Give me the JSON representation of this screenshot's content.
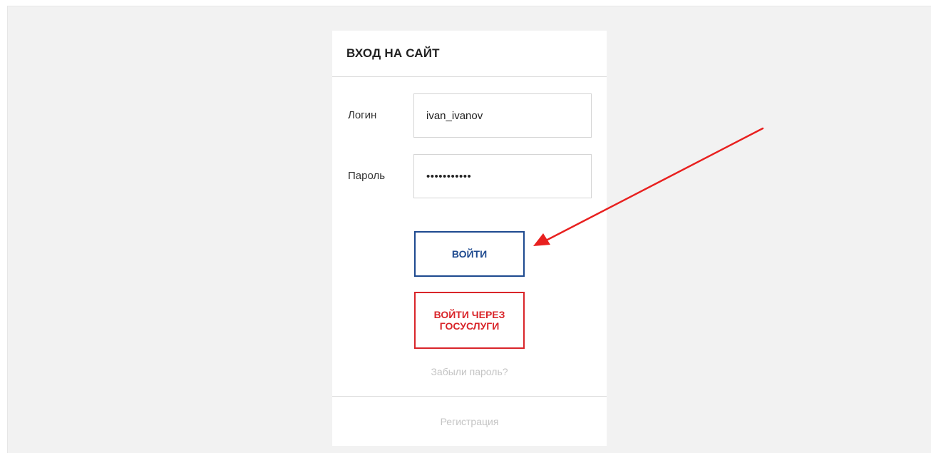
{
  "login_form": {
    "title": "ВХОД НА САЙТ",
    "login_label": "Логин",
    "login_value": "ivan_ivanov",
    "password_label": "Пароль",
    "password_value": "•••••••••••",
    "submit_label": "ВОЙТИ",
    "gosuslugi_label": "ВОЙТИ ЧЕРЕЗ ГОСУСЛУГИ",
    "forgot_password": "Забыли пароль?",
    "register": "Регистрация"
  },
  "colors": {
    "background": "#f2f2f2",
    "card": "#ffffff",
    "primary_blue": "#1e4a8f",
    "gosuslugi_red": "#d9252a",
    "annotation_arrow": "#e8201f",
    "muted_link": "#c4c4c4"
  },
  "annotation": {
    "icon": "red-arrow-icon",
    "points_to": "login-submit-button"
  }
}
